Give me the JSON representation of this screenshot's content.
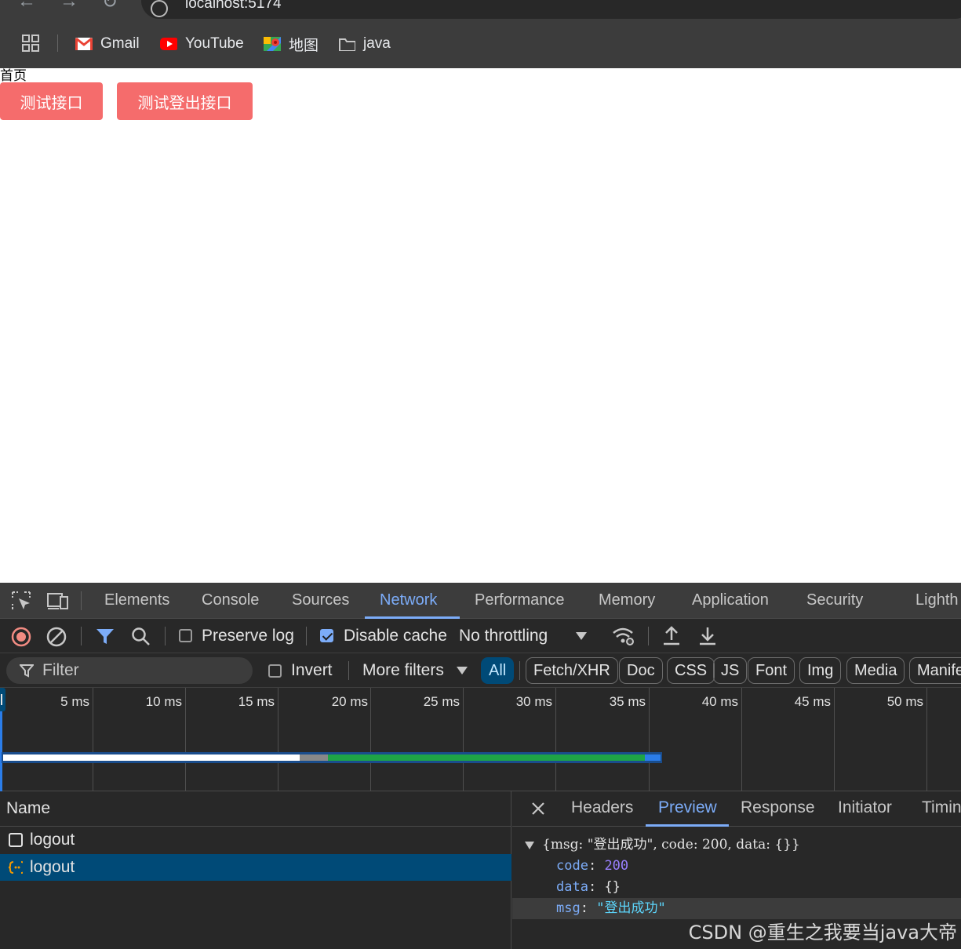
{
  "browser": {
    "url": "localhost:5174",
    "bookmarks": [
      {
        "label": "Gmail",
        "icon": "gmail-icon"
      },
      {
        "label": "YouTube",
        "icon": "youtube-icon"
      },
      {
        "label": "地图",
        "icon": "maps-icon"
      },
      {
        "label": "java",
        "icon": "folder-icon"
      }
    ]
  },
  "page": {
    "title": "首页",
    "buttons": [
      "测试接口",
      "测试登出接口"
    ],
    "button_color": "#f56c6c"
  },
  "devtools": {
    "tabs": [
      "Elements",
      "Console",
      "Sources",
      "Network",
      "Performance",
      "Memory",
      "Application",
      "Security",
      "Lighth"
    ],
    "active_tab": "Network",
    "toolbar": {
      "preserve_log": "Preserve log",
      "preserve_log_checked": false,
      "disable_cache": "Disable cache",
      "disable_cache_checked": true,
      "throttling": "No throttling"
    },
    "filter": {
      "placeholder": "Filter",
      "invert": "Invert",
      "more_filters": "More filters",
      "types": [
        "All",
        "Fetch/XHR",
        "Doc",
        "CSS",
        "JS",
        "Font",
        "Img",
        "Media",
        "Manife"
      ],
      "active_type": "All"
    },
    "timeline": {
      "ticks": [
        "5 ms",
        "10 ms",
        "15 ms",
        "20 ms",
        "25 ms",
        "30 ms",
        "35 ms",
        "40 ms",
        "45 ms",
        "50 ms"
      ],
      "colors": {
        "waiting": "#ffffff",
        "stalled": "#888888",
        "download": "#1ea446",
        "end": "#2b7de9"
      }
    },
    "requests": {
      "header": "Name",
      "rows": [
        {
          "name": "logout",
          "icon": "document-icon",
          "selected": false
        },
        {
          "name": "logout",
          "icon": "fetch-icon",
          "selected": true
        }
      ]
    },
    "detail": {
      "tabs": [
        "Headers",
        "Preview",
        "Response",
        "Initiator",
        "Timin"
      ],
      "active_tab": "Preview",
      "preview": {
        "summary_open": "{msg: ",
        "summary_msg": "\"登出成功\"",
        "summary_rest": ", code: 200, data: {}}",
        "lines": [
          {
            "key": "code",
            "value": "200",
            "type": "number"
          },
          {
            "key": "data",
            "value": "{}",
            "type": "object"
          },
          {
            "key": "msg",
            "value": "\"登出成功\"",
            "type": "string"
          }
        ]
      }
    }
  },
  "watermark": "CSDN @重生之我要当java大帝"
}
